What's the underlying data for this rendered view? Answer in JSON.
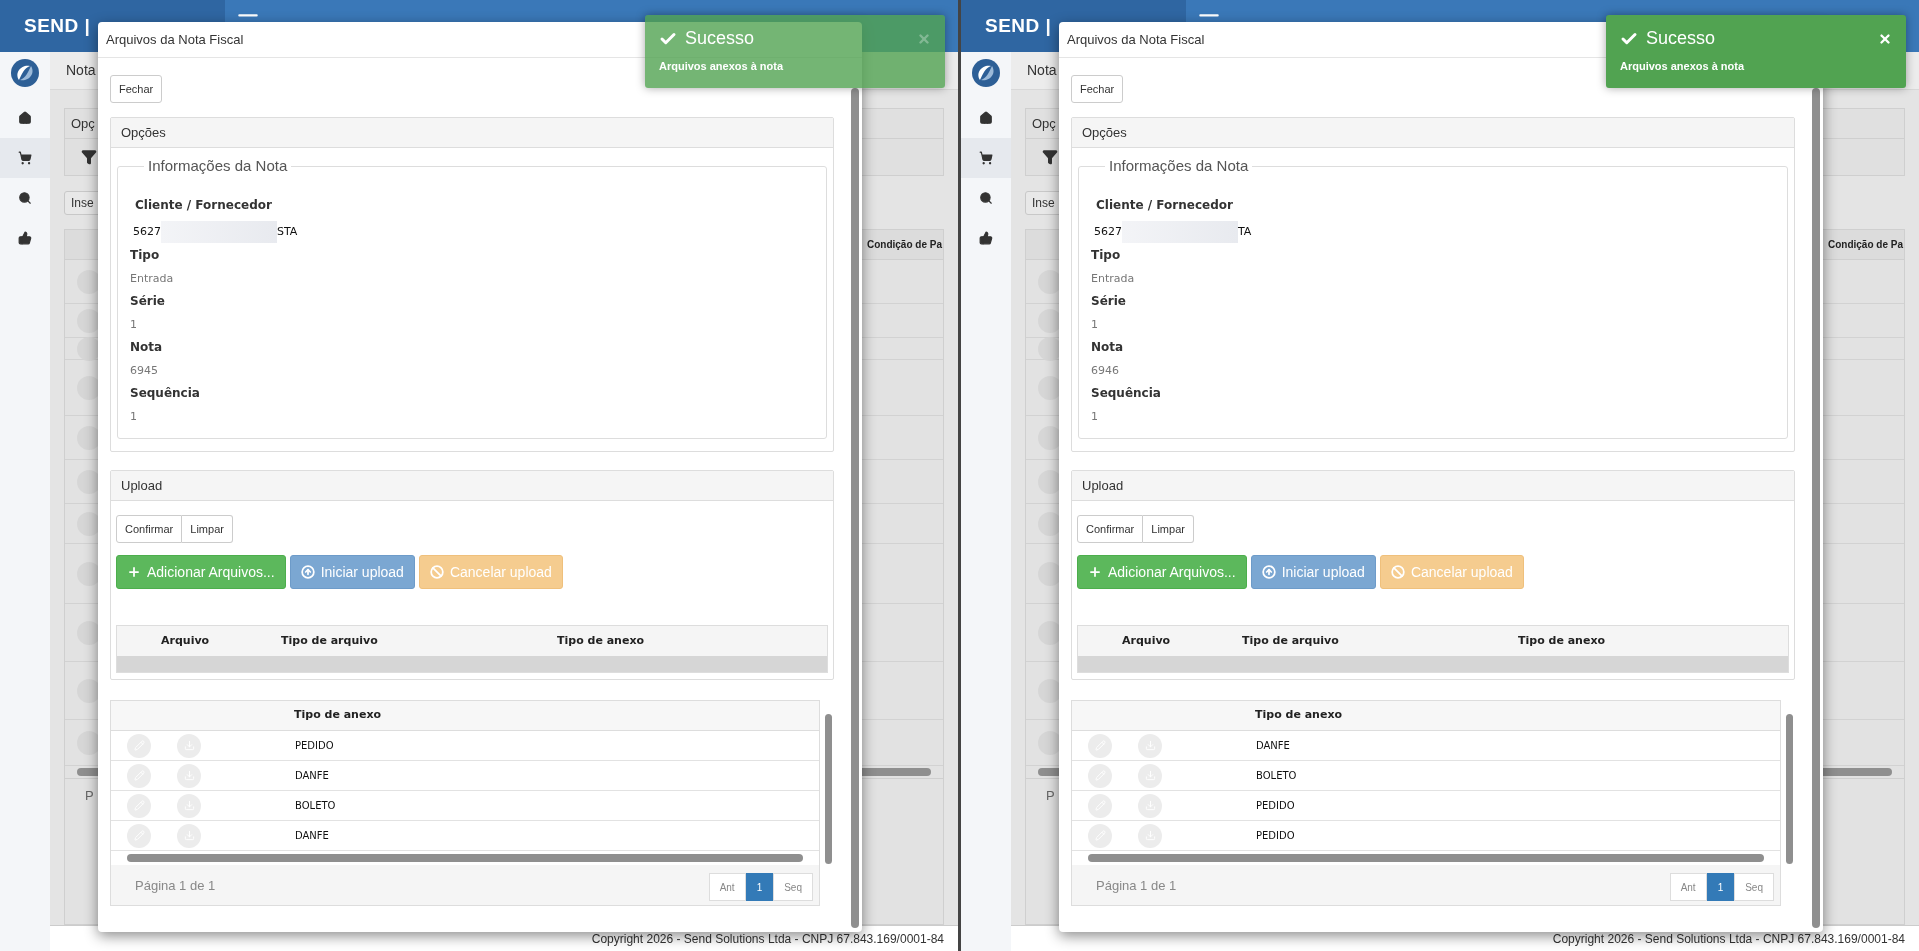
{
  "panes": [
    {
      "header": {
        "brand": "SEND |"
      },
      "sidebar": {
        "items": [
          {
            "kind": "home",
            "selected": false
          },
          {
            "kind": "cart",
            "selected": true
          },
          {
            "kind": "search",
            "selected": false
          },
          {
            "kind": "like",
            "selected": false
          }
        ]
      },
      "background": {
        "breadcrumb": "Nota",
        "panel_title": "Opç",
        "insert_button": "Inse",
        "column_header": "Condição de Pa",
        "pager_text": "P",
        "footer": "Copyright 2026 - Send Solutions Ltda - CNPJ 67.843.169/0001-84"
      },
      "modal": {
        "title": "Arquivos da Nota Fiscal",
        "close_button": "Fechar",
        "options": {
          "title": "Opções",
          "legend": "Informações da Nota",
          "client_label": "Cliente / Fornecedor",
          "client_start": "5627",
          "client_end": "STA",
          "fields": [
            {
              "label": "Tipo",
              "value": "Entrada"
            },
            {
              "label": "Série",
              "value": "1"
            },
            {
              "label": "Nota",
              "value": "6945"
            },
            {
              "label": "Sequência",
              "value": "1"
            }
          ]
        },
        "upload": {
          "title": "Upload",
          "buttons": [
            "Confirmar",
            "Limpar"
          ],
          "actions": [
            {
              "kind": "add",
              "label": "Adicionar Arquivos..."
            },
            {
              "kind": "start",
              "label": "Iniciar upload"
            },
            {
              "kind": "cancel",
              "label": "Cancelar upload"
            }
          ],
          "columns": [
            "Arquivo",
            "Tipo de arquivo",
            "Tipo de anexo"
          ]
        },
        "attachments": {
          "column": "Tipo de anexo",
          "rows": [
            "PEDIDO",
            "DANFE",
            "BOLETO",
            "DANFE"
          ],
          "pager": {
            "text": "Página 1 de 1",
            "buttons": [
              {
                "label": "Ant",
                "selected": false
              },
              {
                "label": "1",
                "selected": true
              },
              {
                "label": "Seq",
                "selected": false
              }
            ]
          }
        }
      },
      "toast": {
        "title": "Sucesso",
        "message": "Arquivos anexos à nota",
        "fading": true
      }
    },
    {
      "header": {
        "brand": "SEND |"
      },
      "sidebar": {
        "items": [
          {
            "kind": "home",
            "selected": false
          },
          {
            "kind": "cart",
            "selected": true
          },
          {
            "kind": "search",
            "selected": false
          },
          {
            "kind": "like",
            "selected": false
          }
        ]
      },
      "background": {
        "breadcrumb": "Nota",
        "panel_title": "Opç",
        "insert_button": "Inse",
        "column_header": "Condição de Pa",
        "pager_text": "P",
        "footer": "Copyright 2026 - Send Solutions Ltda - CNPJ 67.843.169/0001-84"
      },
      "modal": {
        "title": "Arquivos da Nota Fiscal",
        "close_button": "Fechar",
        "options": {
          "title": "Opções",
          "legend": "Informações da Nota",
          "client_label": "Cliente / Fornecedor",
          "client_start": "5627",
          "client_end": "TA",
          "fields": [
            {
              "label": "Tipo",
              "value": "Entrada"
            },
            {
              "label": "Série",
              "value": "1"
            },
            {
              "label": "Nota",
              "value": "6946"
            },
            {
              "label": "Sequência",
              "value": "1"
            }
          ]
        },
        "upload": {
          "title": "Upload",
          "buttons": [
            "Confirmar",
            "Limpar"
          ],
          "actions": [
            {
              "kind": "add",
              "label": "Adicionar Arquivos..."
            },
            {
              "kind": "start",
              "label": "Iniciar upload"
            },
            {
              "kind": "cancel",
              "label": "Cancelar upload"
            }
          ],
          "columns": [
            "Arquivo",
            "Tipo de arquivo",
            "Tipo de anexo"
          ]
        },
        "attachments": {
          "column": "Tipo de anexo",
          "rows": [
            "DANFE",
            "BOLETO",
            "PEDIDO",
            "PEDIDO"
          ],
          "pager": {
            "text": "Página 1 de 1",
            "buttons": [
              {
                "label": "Ant",
                "selected": false
              },
              {
                "label": "1",
                "selected": true
              },
              {
                "label": "Seq",
                "selected": false
              }
            ]
          }
        }
      },
      "toast": {
        "title": "Sucesso",
        "message": "Arquivos anexos à nota",
        "fading": false
      }
    }
  ]
}
